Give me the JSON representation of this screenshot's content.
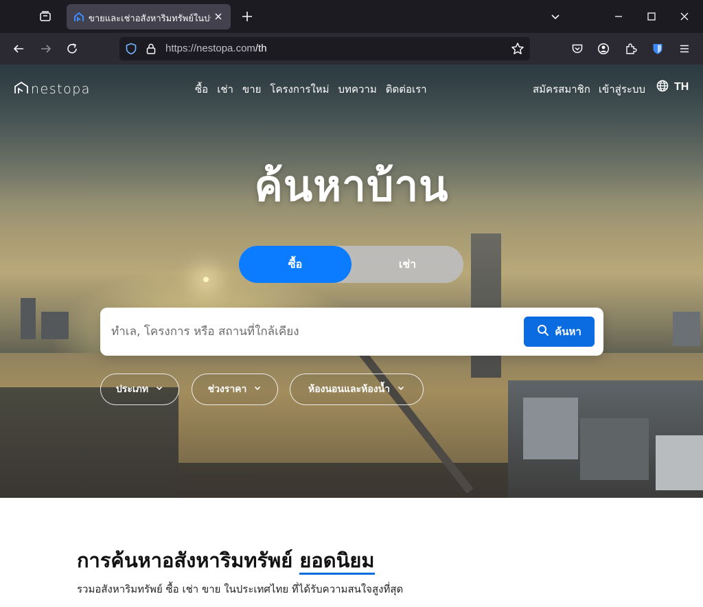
{
  "browser": {
    "tab_title": "ขายและเช่าอสังหาริมทรัพย์ในประเทศไทย",
    "url_host": "https://nestopa.com",
    "url_path": "/th"
  },
  "site": {
    "logo_text": "nestopa",
    "nav": [
      "ซื้อ",
      "เช่า",
      "ขาย",
      "โครงการใหม่",
      "บทความ",
      "ติดต่อเรา"
    ],
    "register": "สมัครสมาชิก",
    "login": "เข้าสู่ระบบ",
    "language": "TH"
  },
  "hero": {
    "title": "ค้นหาบ้าน",
    "toggle": {
      "buy": "ซื้อ",
      "rent": "เช่า",
      "selected": "buy"
    },
    "search_placeholder": "ทำเล, โครงการ หรือ สถานที่ใกล้เคียง",
    "search_button": "ค้นหา",
    "filters": [
      "ประเภท",
      "ช่วงราคา",
      "ห้องนอนและห้องน้ำ"
    ]
  },
  "section": {
    "title_main": "การค้นหาอสังหาริมทรัพย์",
    "title_highlight": "ยอดนิยม",
    "subtitle": "รวมอสังหาริมทรัพย์ ซื้อ เช่า ขาย ในประเทศไทย ที่ได้รับความสนใจสูงที่สุด"
  },
  "colors": {
    "accent": "#0b7cff",
    "button_blue": "#0b6be0",
    "chrome_dark": "#1c1b22",
    "chrome_mid": "#2b2a33"
  }
}
